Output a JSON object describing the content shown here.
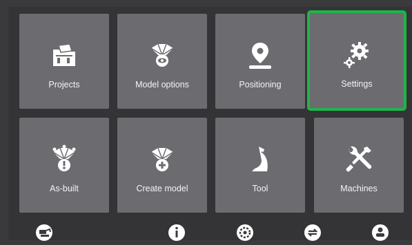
{
  "tiles": [
    {
      "label": "Projects",
      "icon": "projects-icon",
      "selected": false
    },
    {
      "label": "Model options",
      "icon": "model-options-icon",
      "selected": false
    },
    {
      "label": "Positioning",
      "icon": "positioning-pin-icon",
      "selected": false
    },
    {
      "label": "Settings",
      "icon": "settings-gears-icon",
      "selected": true
    },
    {
      "label": "As-built",
      "icon": "as-built-icon",
      "selected": false
    },
    {
      "label": "Create model",
      "icon": "create-model-icon",
      "selected": false
    },
    {
      "label": "Tool",
      "icon": "bucket-tool-icon",
      "selected": false
    },
    {
      "label": "Machines",
      "icon": "wrench-screwdriver-icon",
      "selected": false
    }
  ],
  "colors": {
    "tile": "#6c6c70",
    "selected_border": "#1fb34a",
    "text": "#f4f4f4",
    "background": "#343436"
  },
  "bottom_icons": [
    "excavator-icon",
    "info-icon",
    "gear-cycle-icon",
    "sync-icon",
    "user-machine-icon"
  ]
}
